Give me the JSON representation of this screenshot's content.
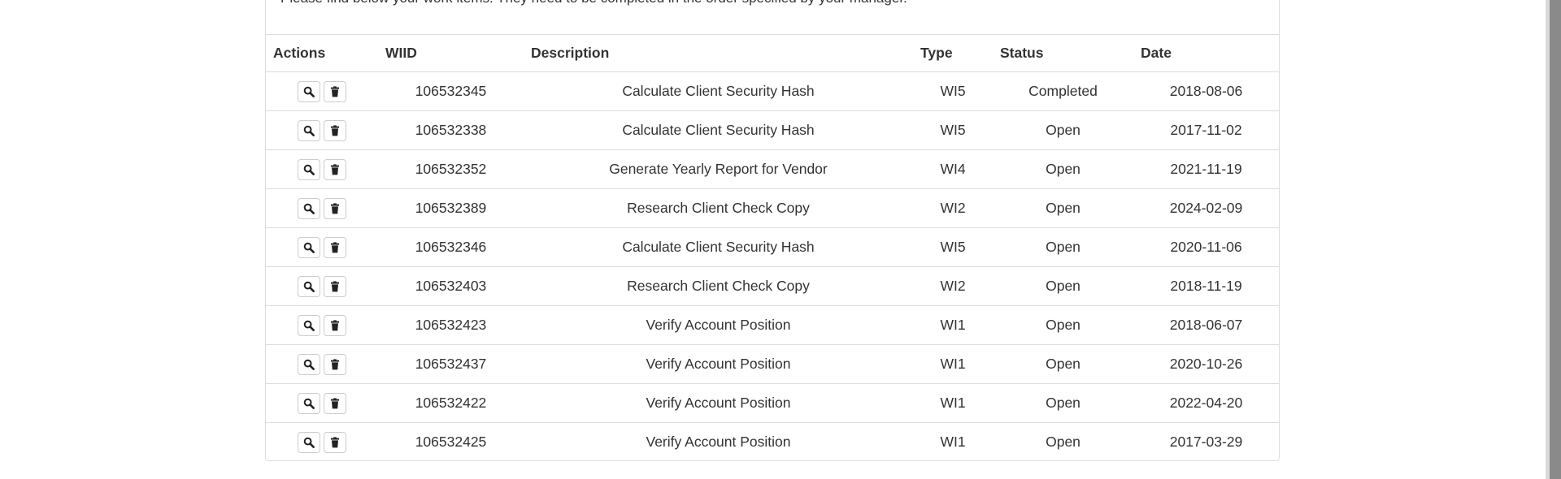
{
  "intro_text": "Please find below your work items. They need to be completed in the order specified by your manager.",
  "table": {
    "headers": {
      "actions": "Actions",
      "wiid": "WIID",
      "description": "Description",
      "type": "Type",
      "status": "Status",
      "date": "Date"
    },
    "rows": [
      {
        "wiid": "106532345",
        "description": "Calculate Client Security Hash",
        "type": "WI5",
        "status": "Completed",
        "date": "2018-08-06"
      },
      {
        "wiid": "106532338",
        "description": "Calculate Client Security Hash",
        "type": "WI5",
        "status": "Open",
        "date": "2017-11-02"
      },
      {
        "wiid": "106532352",
        "description": "Generate Yearly Report for Vendor",
        "type": "WI4",
        "status": "Open",
        "date": "2021-11-19"
      },
      {
        "wiid": "106532389",
        "description": "Research Client Check Copy",
        "type": "WI2",
        "status": "Open",
        "date": "2024-02-09"
      },
      {
        "wiid": "106532346",
        "description": "Calculate Client Security Hash",
        "type": "WI5",
        "status": "Open",
        "date": "2020-11-06"
      },
      {
        "wiid": "106532403",
        "description": "Research Client Check Copy",
        "type": "WI2",
        "status": "Open",
        "date": "2018-11-19"
      },
      {
        "wiid": "106532423",
        "description": "Verify Account Position",
        "type": "WI1",
        "status": "Open",
        "date": "2018-06-07"
      },
      {
        "wiid": "106532437",
        "description": "Verify Account Position",
        "type": "WI1",
        "status": "Open",
        "date": "2020-10-26"
      },
      {
        "wiid": "106532422",
        "description": "Verify Account Position",
        "type": "WI1",
        "status": "Open",
        "date": "2022-04-20"
      },
      {
        "wiid": "106532425",
        "description": "Verify Account Position",
        "type": "WI1",
        "status": "Open",
        "date": "2017-03-29"
      }
    ]
  },
  "icons": {
    "view": "search-icon",
    "delete": "trash-icon"
  }
}
